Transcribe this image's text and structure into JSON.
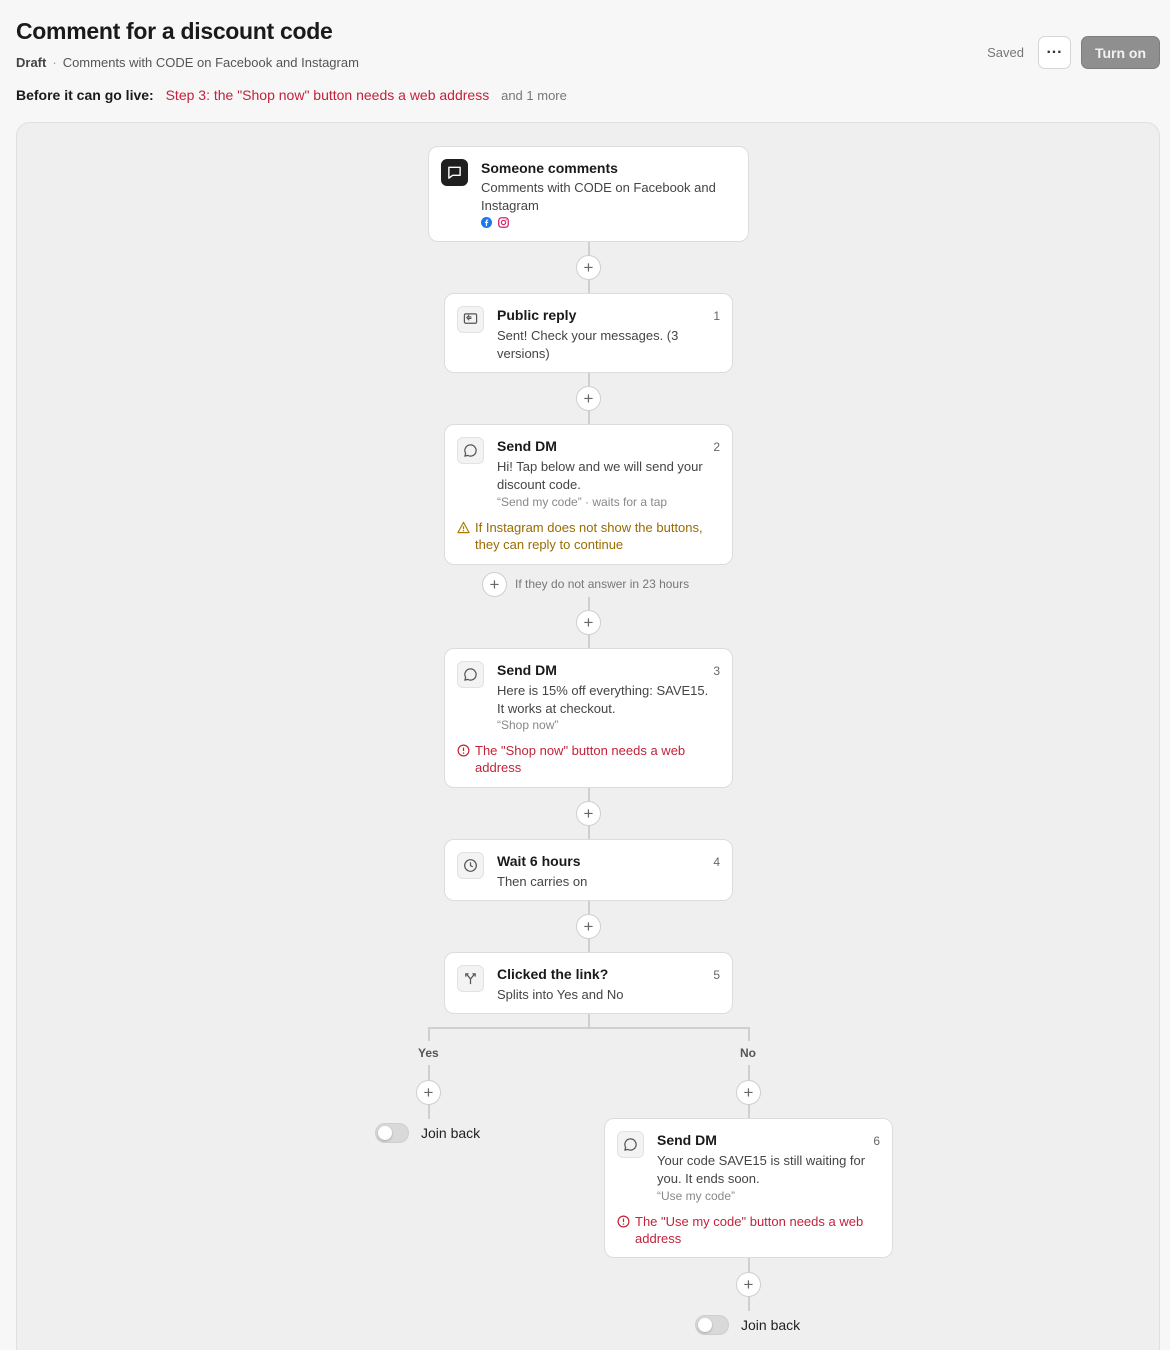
{
  "header": {
    "title": "Comment for a discount code",
    "status": "Draft",
    "separator": "·",
    "subtitle": "Comments with CODE on Facebook and Instagram",
    "saved": "Saved",
    "more_label": "···",
    "turn_on": "Turn on"
  },
  "golive": {
    "label": "Before it can go live:",
    "error": "Step 3: the \"Shop now\" button needs a web address",
    "more": "and 1 more"
  },
  "flow": {
    "trigger": {
      "title": "Someone comments",
      "description": "Comments with CODE on Facebook and Instagram",
      "platforms": [
        "facebook-icon",
        "instagram-icon"
      ]
    },
    "step1": {
      "title": "Public reply",
      "number": "1",
      "description": "Sent! Check your messages. (3 versions)",
      "icon": "reply-icon"
    },
    "step2": {
      "title": "Send DM",
      "number": "2",
      "description": "Hi! Tap below and we will send your discount code.",
      "hint": "“Send my code” · waits for a tap",
      "warning": "If Instagram does not show the buttons, they can reply to continue",
      "icon": "message-icon"
    },
    "no_answer": "If they do not answer in 23 hours",
    "step3": {
      "title": "Send DM",
      "number": "3",
      "description": "Here is 15% off everything: SAVE15. It works at checkout.",
      "hint": "“Shop now”",
      "error": "The \"Shop now\" button needs a web address",
      "icon": "message-icon"
    },
    "step4": {
      "title": "Wait 6 hours",
      "number": "4",
      "description": "Then carries on",
      "icon": "clock-icon"
    },
    "step5": {
      "title": "Clicked the link?",
      "number": "5",
      "description": "Splits into Yes and No",
      "icon": "split-icon"
    },
    "branch_yes": "Yes",
    "branch_no": "No",
    "join_back": "Join back",
    "step6": {
      "title": "Send DM",
      "number": "6",
      "description": "Your code SAVE15 is still waiting for you. It ends soon.",
      "hint": "“Use my code”",
      "error": "The \"Use my code\" button needs a web address",
      "icon": "message-icon"
    }
  },
  "colors": {
    "error": "#c3223a",
    "warning": "#9a6b00",
    "facebook": "#1877f2",
    "instagram": "#d6246e"
  }
}
